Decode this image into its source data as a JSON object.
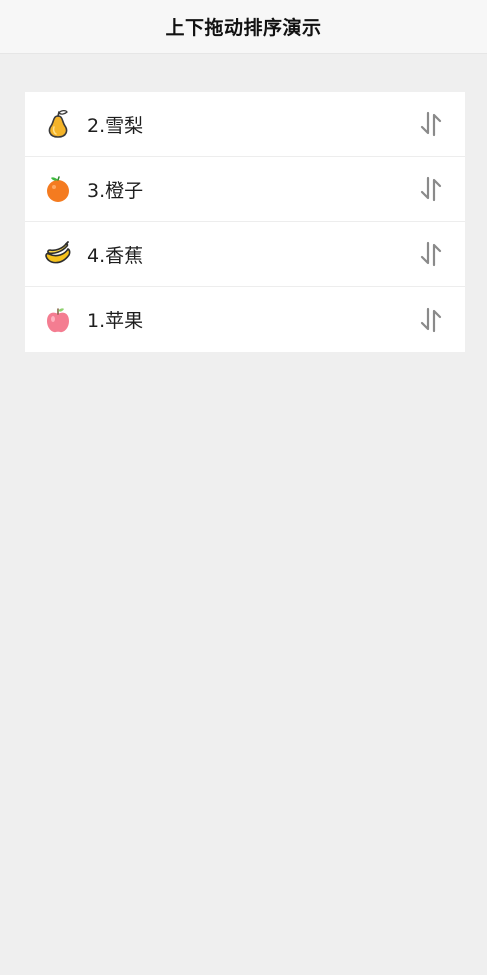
{
  "header": {
    "title": "上下拖动排序演示"
  },
  "items": [
    {
      "label": "2.雪梨",
      "icon": "pear-icon"
    },
    {
      "label": "3.橙子",
      "icon": "orange-icon"
    },
    {
      "label": "4.香蕉",
      "icon": "banana-icon"
    },
    {
      "label": "1.苹果",
      "icon": "apple-icon"
    }
  ],
  "colors": {
    "background": "#efefef",
    "header": "#f7f7f7",
    "card": "#ffffff",
    "drag_handle": "#8a8a8a"
  }
}
